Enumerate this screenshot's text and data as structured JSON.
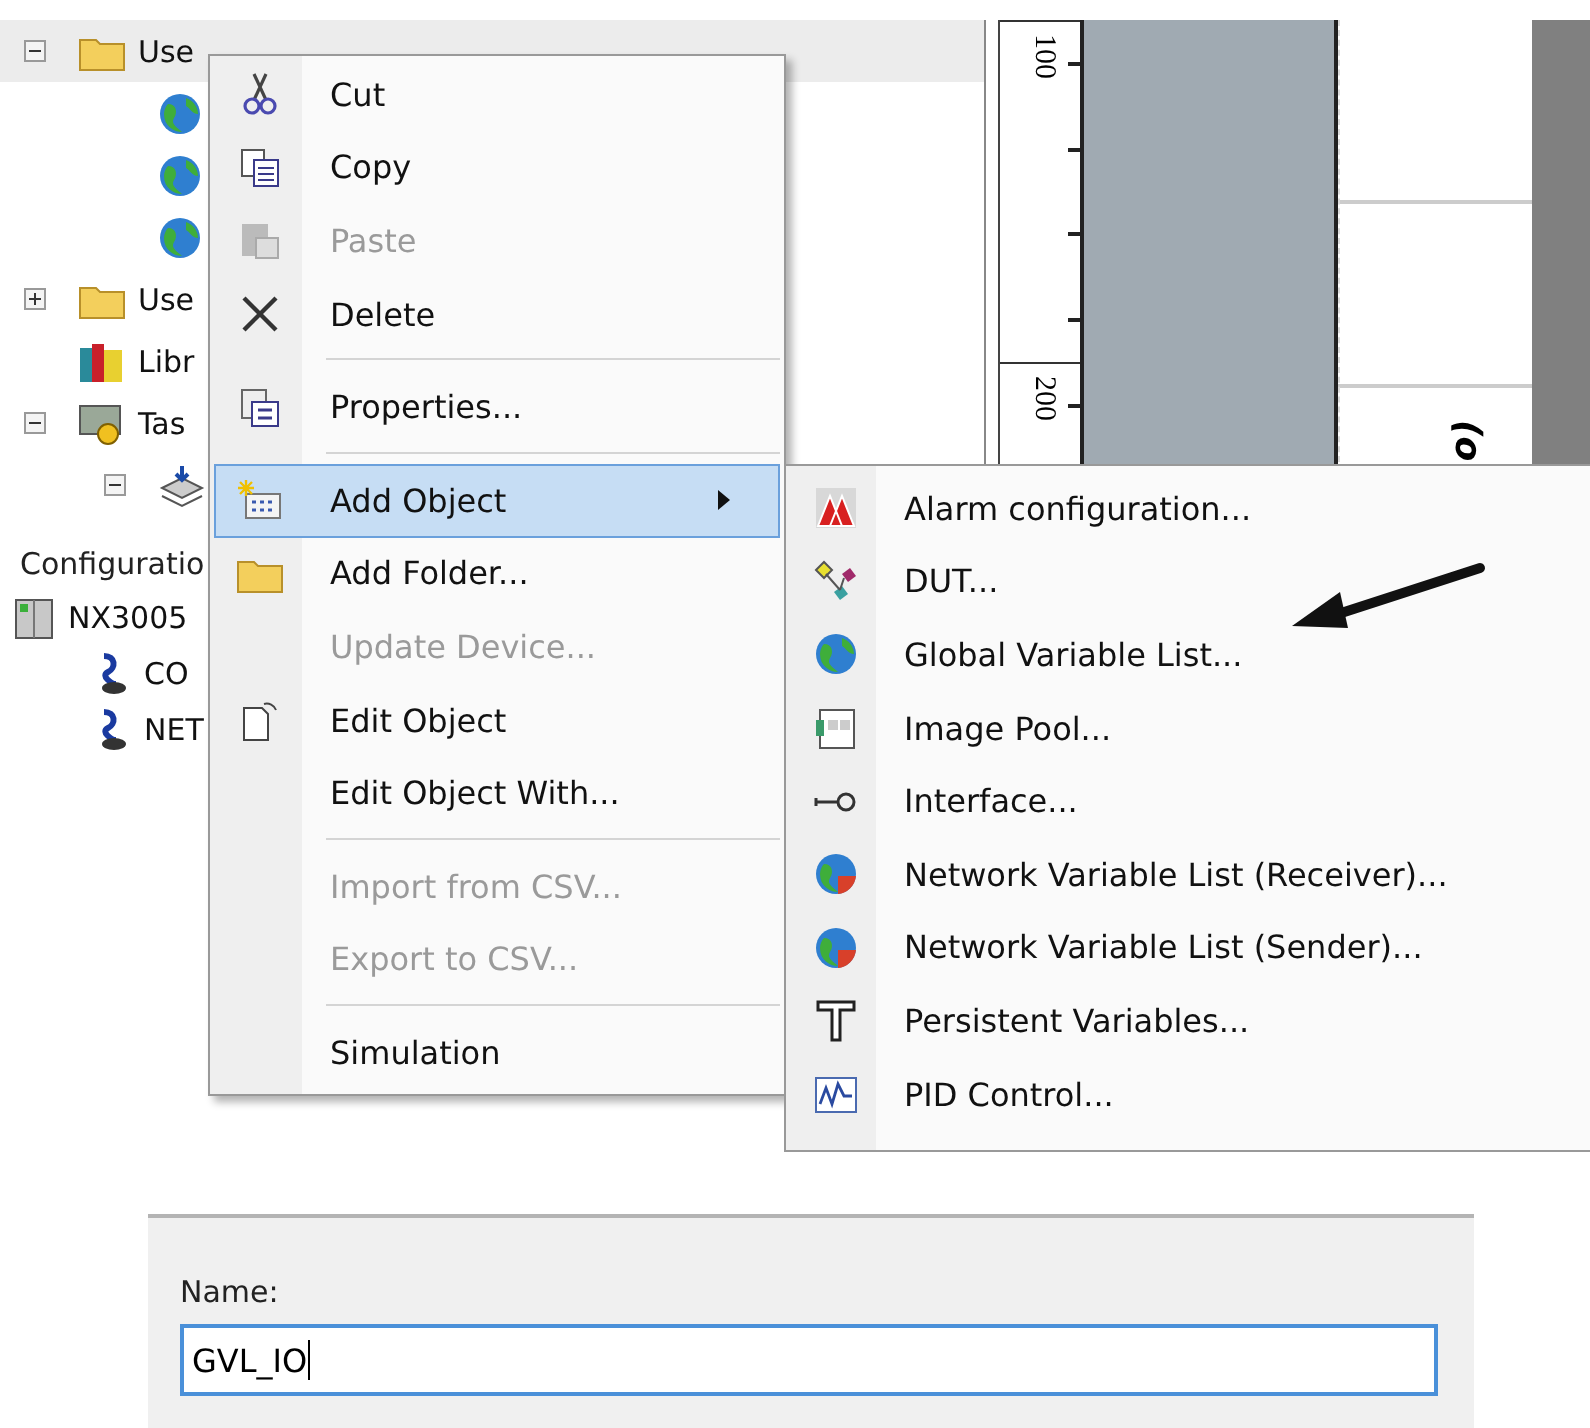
{
  "tree": {
    "items": [
      {
        "label": "Use",
        "kind": "folder",
        "expanded": true,
        "selected": true,
        "children": [
          {
            "kind": "globe",
            "selected": false
          },
          {
            "kind": "globe",
            "selected": false
          },
          {
            "kind": "globe",
            "selected": false
          }
        ]
      },
      {
        "label": "Use",
        "kind": "folder",
        "expanded": false,
        "selected": false
      },
      {
        "label": "Libr",
        "kind": "library",
        "selected": false
      },
      {
        "label": "Tas",
        "kind": "task",
        "expanded": true,
        "selected": false,
        "children": [
          {
            "kind": "stack",
            "expanded": true,
            "selected": false
          }
        ]
      }
    ]
  },
  "configuration": {
    "heading": "Configuratio",
    "items": [
      {
        "label": "NX3005",
        "kind": "device",
        "selected": false,
        "children": [
          {
            "label": "CO",
            "kind": "connector",
            "selected": false
          },
          {
            "label": "NET",
            "kind": "connector",
            "selected": false
          }
        ]
      }
    ]
  },
  "ruler": {
    "ticks": [
      "100",
      "200"
    ]
  },
  "canvas": {
    "label": "(o"
  },
  "context_menu": {
    "items": [
      {
        "kind": "scissors",
        "label": "Cut",
        "disabled": false,
        "selected": false
      },
      {
        "kind": "copy",
        "label": "Copy",
        "disabled": false,
        "selected": false
      },
      {
        "kind": "paste",
        "label": "Paste",
        "disabled": true,
        "selected": false
      },
      {
        "kind": "delete",
        "label": "Delete",
        "disabled": false,
        "selected": false
      },
      {
        "kind": "separator"
      },
      {
        "kind": "properties",
        "label": "Properties...",
        "disabled": false,
        "selected": false
      },
      {
        "kind": "separator"
      },
      {
        "kind": "add",
        "label": "Add Object",
        "disabled": false,
        "selected": true,
        "submenu": true
      },
      {
        "kind": "folder",
        "label": "Add Folder...",
        "disabled": false,
        "selected": false
      },
      {
        "kind": "plain",
        "label": "Update Device...",
        "disabled": true,
        "selected": false
      },
      {
        "kind": "edit",
        "label": "Edit Object",
        "disabled": false,
        "selected": false
      },
      {
        "kind": "plain",
        "label": "Edit Object With...",
        "disabled": false,
        "selected": false
      },
      {
        "kind": "separator"
      },
      {
        "kind": "plain",
        "label": "Import from CSV...",
        "disabled": true,
        "selected": false
      },
      {
        "kind": "plain",
        "label": "Export to CSV...",
        "disabled": true,
        "selected": false
      },
      {
        "kind": "separator"
      },
      {
        "kind": "plain",
        "label": "Simulation",
        "disabled": false,
        "selected": false
      }
    ]
  },
  "submenu": {
    "items": [
      {
        "label": "Alarm configuration...",
        "kind": "alarm"
      },
      {
        "label": "DUT...",
        "kind": "dut"
      },
      {
        "label": "Global Variable List...",
        "kind": "globe"
      },
      {
        "label": "Image Pool...",
        "kind": "image"
      },
      {
        "label": "Interface...",
        "kind": "interface"
      },
      {
        "label": "Network Variable List (Receiver)...",
        "kind": "netglobe"
      },
      {
        "label": "Network Variable List (Sender)...",
        "kind": "netglobe"
      },
      {
        "label": "Persistent Variables...",
        "kind": "persistent"
      },
      {
        "label": "PID Control...",
        "kind": "pid"
      }
    ]
  },
  "name_field": {
    "label": "Name:",
    "value": "GVL_IO",
    "focused": true
  }
}
